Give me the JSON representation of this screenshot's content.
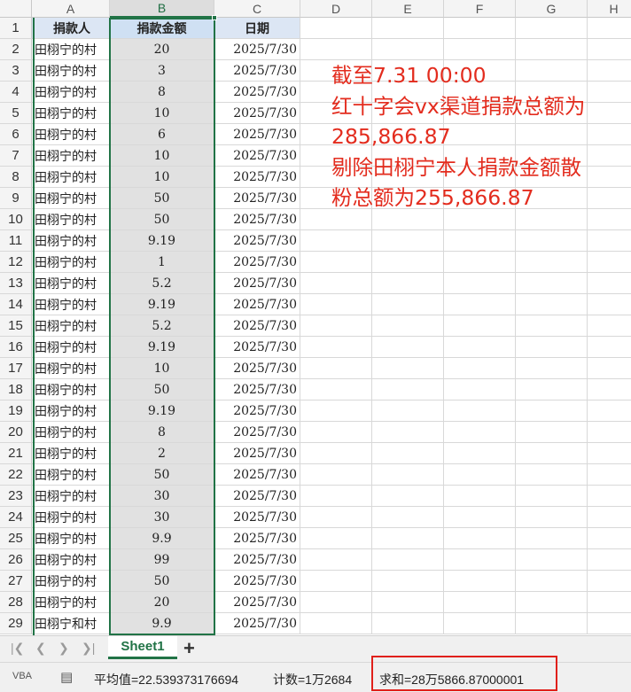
{
  "columns": [
    "A",
    "B",
    "C",
    "D",
    "E",
    "F",
    "G",
    "H"
  ],
  "header_row": {
    "donor": "捐款人",
    "amount": "捐款金额",
    "date": "日期"
  },
  "rows": [
    {
      "n": "2",
      "donor": "田栩宁的村",
      "amount": "20",
      "date": "2025/7/30"
    },
    {
      "n": "3",
      "donor": "田栩宁的村",
      "amount": "3",
      "date": "2025/7/30"
    },
    {
      "n": "4",
      "donor": "田栩宁的村",
      "amount": "8",
      "date": "2025/7/30"
    },
    {
      "n": "5",
      "donor": "田栩宁的村",
      "amount": "10",
      "date": "2025/7/30"
    },
    {
      "n": "6",
      "donor": "田栩宁的村",
      "amount": "6",
      "date": "2025/7/30"
    },
    {
      "n": "7",
      "donor": "田栩宁的村",
      "amount": "10",
      "date": "2025/7/30"
    },
    {
      "n": "8",
      "donor": "田栩宁的村",
      "amount": "10",
      "date": "2025/7/30"
    },
    {
      "n": "9",
      "donor": "田栩宁的村",
      "amount": "50",
      "date": "2025/7/30"
    },
    {
      "n": "10",
      "donor": "田栩宁的村",
      "amount": "50",
      "date": "2025/7/30"
    },
    {
      "n": "11",
      "donor": "田栩宁的村",
      "amount": "9.19",
      "date": "2025/7/30"
    },
    {
      "n": "12",
      "donor": "田栩宁的村",
      "amount": "1",
      "date": "2025/7/30"
    },
    {
      "n": "13",
      "donor": "田栩宁的村",
      "amount": "5.2",
      "date": "2025/7/30"
    },
    {
      "n": "14",
      "donor": "田栩宁的村",
      "amount": "9.19",
      "date": "2025/7/30"
    },
    {
      "n": "15",
      "donor": "田栩宁的村",
      "amount": "5.2",
      "date": "2025/7/30"
    },
    {
      "n": "16",
      "donor": "田栩宁的村",
      "amount": "9.19",
      "date": "2025/7/30"
    },
    {
      "n": "17",
      "donor": "田栩宁的村",
      "amount": "10",
      "date": "2025/7/30"
    },
    {
      "n": "18",
      "donor": "田栩宁的村",
      "amount": "50",
      "date": "2025/7/30"
    },
    {
      "n": "19",
      "donor": "田栩宁的村",
      "amount": "9.19",
      "date": "2025/7/30"
    },
    {
      "n": "20",
      "donor": "田栩宁的村",
      "amount": "8",
      "date": "2025/7/30"
    },
    {
      "n": "21",
      "donor": "田栩宁的村",
      "amount": "2",
      "date": "2025/7/30"
    },
    {
      "n": "22",
      "donor": "田栩宁的村",
      "amount": "50",
      "date": "2025/7/30"
    },
    {
      "n": "23",
      "donor": "田栩宁的村",
      "amount": "30",
      "date": "2025/7/30"
    },
    {
      "n": "24",
      "donor": "田栩宁的村",
      "amount": "30",
      "date": "2025/7/30"
    },
    {
      "n": "25",
      "donor": "田栩宁的村",
      "amount": "9.9",
      "date": "2025/7/30"
    },
    {
      "n": "26",
      "donor": "田栩宁的村",
      "amount": "99",
      "date": "2025/7/30"
    },
    {
      "n": "27",
      "donor": "田栩宁的村",
      "amount": "50",
      "date": "2025/7/30"
    },
    {
      "n": "28",
      "donor": "田栩宁的村",
      "amount": "20",
      "date": "2025/7/30"
    },
    {
      "n": "29",
      "donor": "田栩宁和村",
      "amount": "9.9",
      "date": "2025/7/30"
    }
  ],
  "annotation": {
    "lines": [
      "截至7.31 00:00",
      "红十字会vx渠道捐款总额为",
      "285,866.87",
      "剔除田栩宁本人捐款金额散",
      "粉总额为255,866.87"
    ]
  },
  "sheet_tab": "Sheet1",
  "status": {
    "average": "平均值=22.539373176694",
    "count": "计数=1万2684",
    "sum": "求和=28万5866.87000001"
  },
  "icons": {
    "nav_first": "first-sheet-icon",
    "nav_prev": "prev-sheet-icon",
    "nav_next": "next-sheet-icon",
    "nav_last": "last-sheet-icon",
    "add": "add-sheet-icon"
  },
  "colors": {
    "selection": "#217346",
    "annotation": "#e32c1e",
    "sum_highlight": "#e0201a"
  }
}
